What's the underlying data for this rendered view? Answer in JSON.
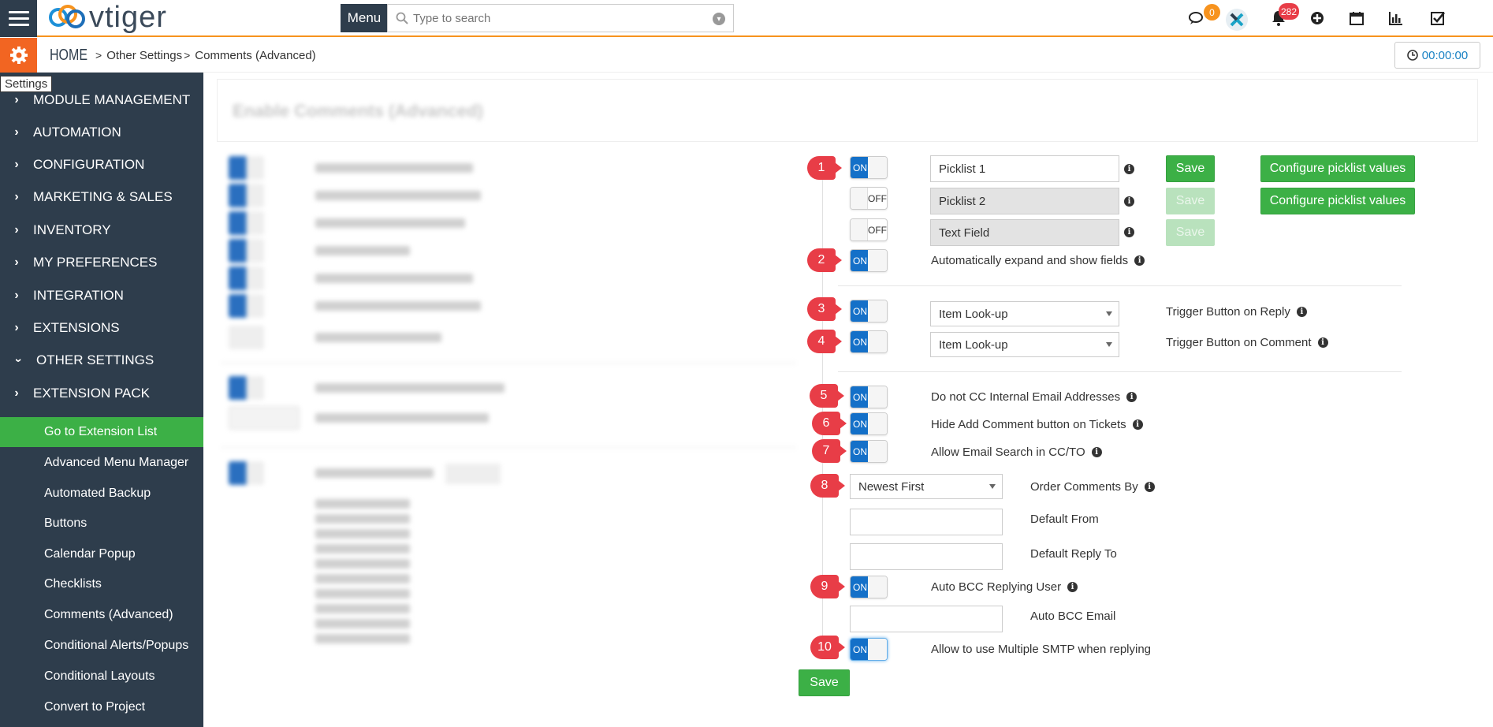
{
  "header": {
    "logo_text": "vtiger",
    "menu_label": "Menu",
    "search_placeholder": "Type to search",
    "chat_badge": "0",
    "notif_badge": "282",
    "timer": "00:00:00"
  },
  "breadcrumb": {
    "home": "HOME",
    "items": [
      "Other Settings",
      "Comments (Advanced)"
    ]
  },
  "tooltip": "Settings",
  "sidebar": {
    "sections": [
      {
        "label": "MODULE MANAGEMENT",
        "expanded": false
      },
      {
        "label": "AUTOMATION",
        "expanded": false
      },
      {
        "label": "CONFIGURATION",
        "expanded": false
      },
      {
        "label": "MARKETING & SALES",
        "expanded": false
      },
      {
        "label": "INVENTORY",
        "expanded": false
      },
      {
        "label": "MY PREFERENCES",
        "expanded": false
      },
      {
        "label": "INTEGRATION",
        "expanded": false
      },
      {
        "label": "EXTENSIONS",
        "expanded": false
      },
      {
        "label": "OTHER SETTINGS",
        "expanded": true
      },
      {
        "label": "EXTENSION PACK",
        "expanded": false
      }
    ],
    "subitems": [
      {
        "label": "Go to Extension List",
        "active": true
      },
      {
        "label": "Advanced Menu Manager",
        "active": false
      },
      {
        "label": "Automated Backup",
        "active": false
      },
      {
        "label": "Buttons",
        "active": false
      },
      {
        "label": "Calendar Popup",
        "active": false
      },
      {
        "label": "Checklists",
        "active": false
      },
      {
        "label": "Comments (Advanced)",
        "active": false
      },
      {
        "label": "Conditional Alerts/Popups",
        "active": false
      },
      {
        "label": "Conditional Layouts",
        "active": false
      },
      {
        "label": "Convert to Project",
        "active": false
      }
    ]
  },
  "blurred_title": "Enable Comments (Advanced)",
  "form": {
    "markers": [
      "1",
      "2",
      "3",
      "4",
      "5",
      "6",
      "7",
      "8",
      "9",
      "10"
    ],
    "toggle_on": "ON",
    "toggle_off": "OFF",
    "picklist1": "Picklist 1",
    "picklist2": "Picklist 2",
    "text_field": "Text Field",
    "save": "Save",
    "configure_picklist": "Configure picklist values",
    "auto_expand": "Automatically expand and show fields",
    "item_lookup": "Item Look-up",
    "trigger_reply": "Trigger Button on Reply",
    "trigger_comment": "Trigger Button on Comment",
    "no_cc": "Do not CC Internal Email Addresses",
    "hide_add_comment": "Hide Add Comment button on Tickets",
    "allow_email_search": "Allow Email Search in CC/TO",
    "order_value": "Newest First",
    "order_label": "Order Comments By",
    "default_from": "Default From",
    "default_reply_to": "Default Reply To",
    "auto_bcc_user": "Auto BCC Replying User",
    "auto_bcc_email": "Auto BCC Email",
    "multi_smtp": "Allow to use Multiple SMTP when replying",
    "save_main": "Save"
  }
}
